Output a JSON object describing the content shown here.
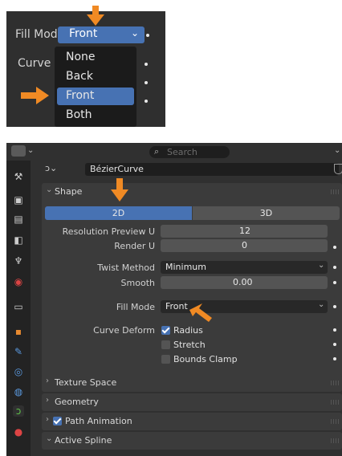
{
  "crop": {
    "fill_mode_label": "Fill Mode",
    "fill_mode_value": "Front",
    "curve_label": "Curve ...",
    "dropdown_options": [
      "None",
      "Back",
      "Front",
      "Both"
    ],
    "selected_option": "Front"
  },
  "panel": {
    "search_placeholder": "Search",
    "object_name": "BézierCurve",
    "sections": {
      "shape": "Shape",
      "texture_space": "Texture Space",
      "geometry": "Geometry",
      "path_animation": "Path Animation",
      "active_spline": "Active Spline"
    },
    "tabs": [
      "2D",
      "3D"
    ],
    "active_tab": "2D",
    "props": {
      "resolution_preview_label": "Resolution Preview U",
      "resolution_preview_value": "12",
      "render_label": "Render U",
      "render_value": "0",
      "twist_method_label": "Twist Method",
      "twist_method_value": "Minimum",
      "smooth_label": "Smooth",
      "smooth_value": "0.00",
      "fill_mode_label": "Fill Mode",
      "fill_mode_value": "Front",
      "curve_deform_label": "Curve Deform",
      "radius_label": "Radius",
      "stretch_label": "Stretch",
      "bounds_clamp_label": "Bounds Clamp"
    },
    "checkboxes": {
      "radius": true,
      "stretch": false,
      "bounds_clamp": false,
      "path_animation": true
    }
  },
  "colors": {
    "accent": "#4772b3",
    "annotation_arrow": "#f08a24",
    "panel_bg": "#303030"
  }
}
